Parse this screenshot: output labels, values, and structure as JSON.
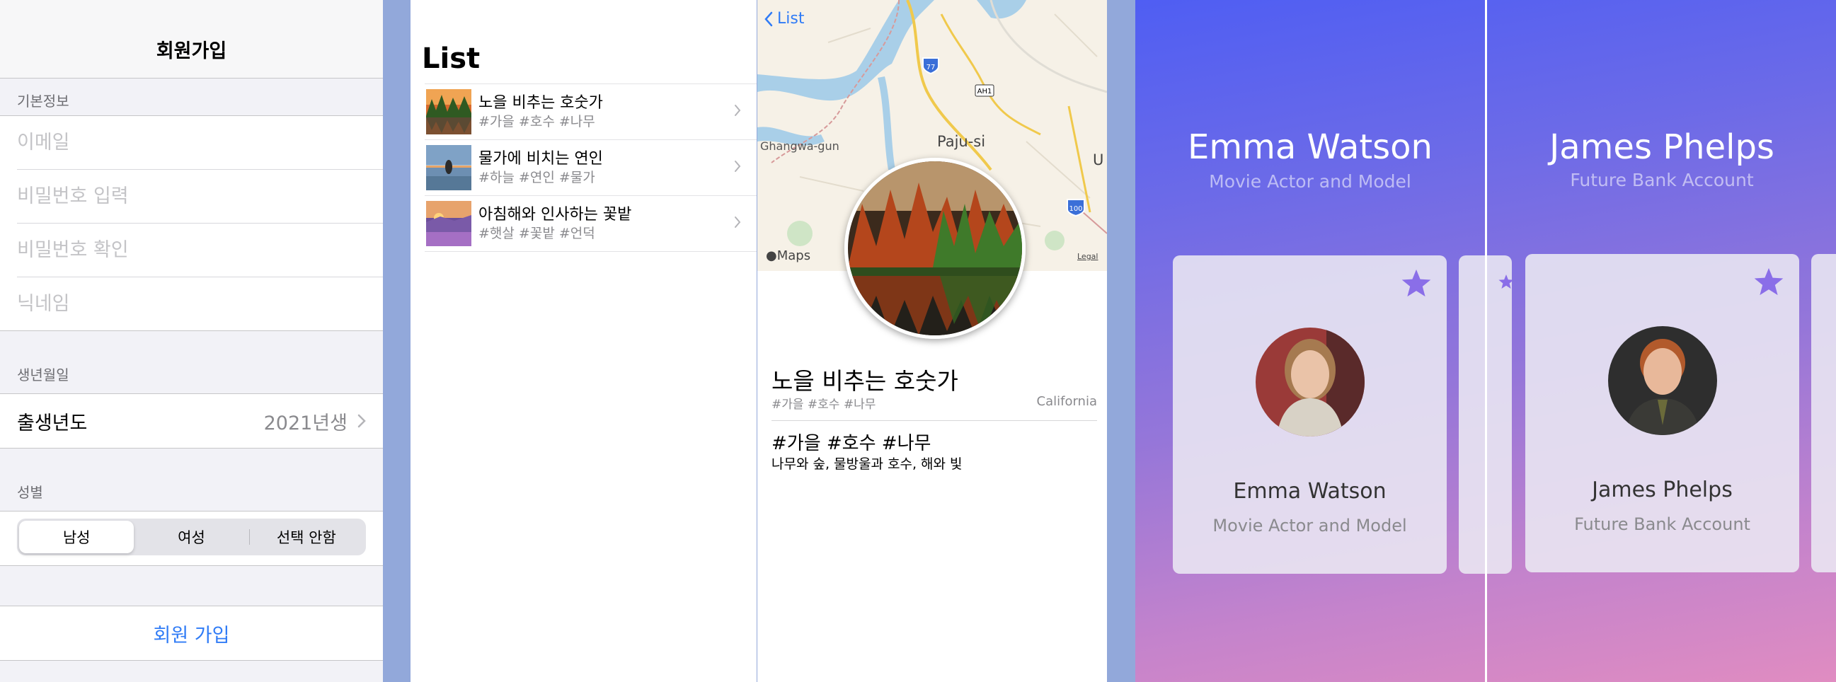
{
  "signup": {
    "nav_title": "회원가입",
    "section_basic": "기본정보",
    "email_placeholder": "이메일",
    "password_placeholder": "비밀번호 입력",
    "password_confirm_placeholder": "비밀번호 확인",
    "nickname_placeholder": "닉네임",
    "section_birth": "생년월일",
    "birth_label": "출생년도",
    "birth_value": "2021년생",
    "section_gender": "성별",
    "gender_options": [
      "남성",
      "여성",
      "선택 안함"
    ],
    "gender_selected": "남성",
    "submit_label": "회원 가입"
  },
  "list": {
    "title": "List",
    "items": [
      {
        "title": "노을 비추는 호숫가",
        "tags": "#가을 #호수 #나무"
      },
      {
        "title": "물가에 비치는 연인",
        "tags": "#하늘 #연인 #물가"
      },
      {
        "title": "아침해와 인사하는 꽃밭",
        "tags": "#햇살 #꽃밭 #언덕"
      }
    ]
  },
  "detail": {
    "back_label": "List",
    "map": {
      "labels": [
        "Ghangwa-gun",
        "Paju-si",
        "U"
      ],
      "road_shields": [
        "77",
        "AH1",
        "100"
      ],
      "brand": "Maps",
      "legal": "Legal"
    },
    "title": "노을 비추는 호숫가",
    "tags": "#가을 #호수 #나무",
    "location": "California",
    "heading": "#가을 #호수 #나무",
    "description": "나무와 숲, 물방울과 호수, 해와 빛"
  },
  "profiles": [
    {
      "name": "Emma Watson",
      "subtitle": "Movie Actor and Model"
    },
    {
      "name": "James Phelps",
      "subtitle": "Future Bank Account"
    }
  ],
  "colors": {
    "ios_blue": "#2f7bf6",
    "gradient_top": "#4f5ef3",
    "gradient_bottom": "#e08cc1",
    "star": "#8a6ee8",
    "gap_background": "#92a8da"
  }
}
